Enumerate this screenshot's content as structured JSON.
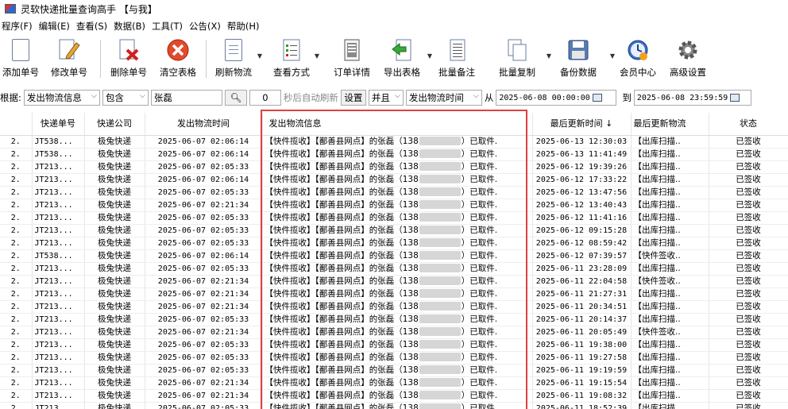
{
  "window": {
    "title": "灵软快递批量查询高手 【与我】"
  },
  "menu": [
    "程序(F)",
    "编辑(E)",
    "查看(S)",
    "数据(B)",
    "工具(T)",
    "公告(X)",
    "帮助(H)"
  ],
  "toolbar": {
    "add": "添加单号",
    "edit": "修改单号",
    "delete": "删除单号",
    "clear": "清空表格",
    "refresh": "刷新物流",
    "view": "查看方式",
    "detail": "订单详情",
    "export": "导出表格",
    "batch_note": "批量备注",
    "batch_copy": "批量复制",
    "backup": "备份数据",
    "member": "会员中心",
    "advanced": "高级设置"
  },
  "filter": {
    "label": "根据:",
    "field": "发出物流信息",
    "op": "包含",
    "keyword": "张磊",
    "seconds": "0",
    "auto_refresh": "秒后自动刷新",
    "settings": "设置",
    "and": "并且",
    "time_field": "发出物流时间",
    "from": "从",
    "from_value": "2025-06-08 00:00:00",
    "to": "到",
    "to_value": "2025-06-08 23:59:59"
  },
  "table": {
    "headers": [
      "",
      "快递单号",
      "快递公司",
      "发出物流时间",
      "发出物流信息",
      "最后更新时间 ↓",
      "最后更新物流",
      "状态"
    ],
    "rows": [
      [
        "2.",
        "JT538...",
        "极兔快递",
        "2025-06-07 02:06:14",
        "【快件揽收】【鄯善县网点】的张磊（138",
        "）已取件.",
        "2025-06-13 12:30:03",
        "【出库扫描..",
        "已签收"
      ],
      [
        "2.",
        "JT538...",
        "极兔快递",
        "2025-06-07 02:06:14",
        "【快件揽收】【鄯善县网点】的张磊（138",
        "）已取件.",
        "2025-06-13 11:41:49",
        "【出库扫描..",
        "已签收"
      ],
      [
        "2.",
        "JT213...",
        "极兔快递",
        "2025-06-07 02:05:33",
        "【快件揽收】【鄯善县网点】的张磊（138",
        "）已取件.",
        "2025-06-12 19:39:26",
        "【出库扫描..",
        "已签收"
      ],
      [
        "2.",
        "JT213...",
        "极兔快递",
        "2025-06-07 02:06:14",
        "【快件揽收】【鄯善县网点】的张磊（138",
        "）已取件.",
        "2025-06-12 17:33:22",
        "【出库扫描..",
        "已签收"
      ],
      [
        "2.",
        "JT213...",
        "极兔快递",
        "2025-06-07 02:05:33",
        "【快件揽收】【鄯善县网点】的张磊（138",
        "）已取件.",
        "2025-06-12 13:47:56",
        "【出库扫描..",
        "已签收"
      ],
      [
        "2.",
        "JT213...",
        "极兔快递",
        "2025-06-07 02:21:34",
        "【快件揽收】【鄯善县网点】的张磊（138",
        "）已取件.",
        "2025-06-12 13:40:43",
        "【出库扫描..",
        "已签收"
      ],
      [
        "2.",
        "JT213...",
        "极兔快递",
        "2025-06-07 02:05:33",
        "【快件揽收】【鄯善县网点】的张磊（138",
        "）已取件.",
        "2025-06-12 11:41:16",
        "【出库扫描..",
        "已签收"
      ],
      [
        "2.",
        "JT213...",
        "极兔快递",
        "2025-06-07 02:05:33",
        "【快件揽收】【鄯善县网点】的张磊（138",
        "）已取件.",
        "2025-06-12 09:15:28",
        "【出库扫描..",
        "已签收"
      ],
      [
        "2.",
        "JT213...",
        "极兔快递",
        "2025-06-07 02:05:33",
        "【快件揽收】【鄯善县网点】的张磊（138",
        "）已取件.",
        "2025-06-12 08:59:42",
        "【出库扫描..",
        "已签收"
      ],
      [
        "2.",
        "JT538...",
        "极兔快递",
        "2025-06-07 02:06:14",
        "【快件揽收】【鄯善县网点】的张磊（138",
        "）已取件.",
        "2025-06-12 07:39:57",
        "【快件签收..",
        "已签收"
      ],
      [
        "2.",
        "JT213...",
        "极兔快递",
        "2025-06-07 02:05:33",
        "【快件揽收】【鄯善县网点】的张磊（138",
        "）已取件.",
        "2025-06-11 23:28:09",
        "【出库扫描..",
        "已签收"
      ],
      [
        "2.",
        "JT213...",
        "极兔快递",
        "2025-06-07 02:21:34",
        "【快件揽收】【鄯善县网点】的张磊（138",
        "）已取件.",
        "2025-06-11 22:04:58",
        "【快件签收..",
        "已签收"
      ],
      [
        "2.",
        "JT213...",
        "极兔快递",
        "2025-06-07 02:21:34",
        "【快件揽收】【鄯善县网点】的张磊（138",
        "）已取件.",
        "2025-06-11 21:27:31",
        "【出库扫描..",
        "已签收"
      ],
      [
        "2.",
        "JT213...",
        "极兔快递",
        "2025-06-07 02:21:34",
        "【快件揽收】【鄯善县网点】的张磊（138",
        "）已取件.",
        "2025-06-11 20:34:51",
        "【出库扫描..",
        "已签收"
      ],
      [
        "2.",
        "JT213...",
        "极兔快递",
        "2025-06-07 02:05:33",
        "【快件揽收】【鄯善县网点】的张磊（138",
        "）已取件.",
        "2025-06-11 20:14:37",
        "【出库扫描..",
        "已签收"
      ],
      [
        "2.",
        "JT213...",
        "极兔快递",
        "2025-06-07 02:21:34",
        "【快件揽收】【鄯善县网点】的张磊（138",
        "）已取件.",
        "2025-06-11 20:05:49",
        "【快件签收..",
        "已签收"
      ],
      [
        "2.",
        "JT213...",
        "极兔快递",
        "2025-06-07 02:05:33",
        "【快件揽收】【鄯善县网点】的张磊（138",
        "）已取件.",
        "2025-06-11 19:38:00",
        "【出库扫描..",
        "已签收"
      ],
      [
        "2.",
        "JT213...",
        "极兔快递",
        "2025-06-07 02:05:33",
        "【快件揽收】【鄯善县网点】的张磊（138",
        "）已取件.",
        "2025-06-11 19:27:58",
        "【出库扫描..",
        "已签收"
      ],
      [
        "2.",
        "JT213...",
        "极兔快递",
        "2025-06-07 02:05:33",
        "【快件揽收】【鄯善县网点】的张磊（138",
        "）已取件.",
        "2025-06-11 19:19:59",
        "【出库扫描..",
        "已签收"
      ],
      [
        "2.",
        "JT213...",
        "极兔快递",
        "2025-06-07 02:21:34",
        "【快件揽收】【鄯善县网点】的张磊（138",
        "）已取件.",
        "2025-06-11 19:15:54",
        "【出库扫描..",
        "已签收"
      ],
      [
        "2.",
        "JT213...",
        "极兔快递",
        "2025-06-07 02:21:34",
        "【快件揽收】【鄯善县网点】的张磊（138",
        "）已取件.",
        "2025-06-11 19:08:32",
        "【出库扫描..",
        "已签收"
      ],
      [
        "2.",
        "JT213",
        "极兔快递",
        "2025-06-07 02:05:33",
        "【快件揽收】【鄯善县网点】的张磊（138",
        "）已取件.",
        "2025-06-11 18:52:39",
        "【出库扫描..",
        "已签收"
      ]
    ]
  }
}
